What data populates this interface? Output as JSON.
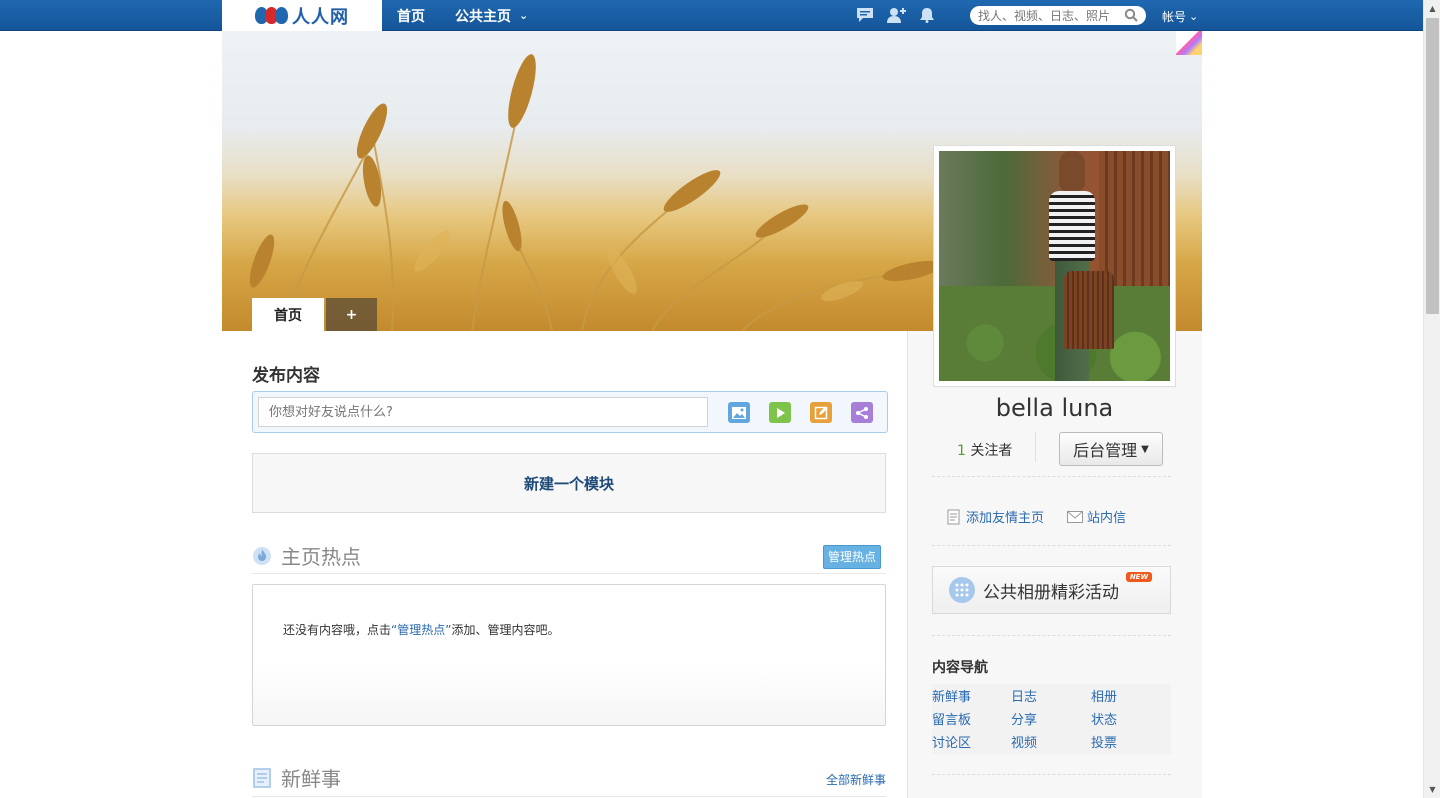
{
  "topbar": {
    "logo_text": "人人网",
    "nav": [
      {
        "label": "首页"
      },
      {
        "label": "公共主页"
      }
    ],
    "search_placeholder": "找人、视频、日志、照片",
    "account_label": "帐号",
    "icons": [
      "chat-icon",
      "add-friend-icon",
      "bell-icon",
      "search-icon"
    ]
  },
  "cover": {
    "tabs": [
      {
        "label": "首页"
      },
      {
        "label": "+"
      }
    ]
  },
  "profile": {
    "name": "bella luna",
    "followers_count": "1",
    "followers_label": "关注者",
    "admin_button": "后台管理",
    "links": [
      {
        "label": "添加友情主页",
        "icon": "document-icon"
      },
      {
        "label": "站内信",
        "icon": "mail-icon"
      }
    ],
    "album_button": "公共相册精彩活动",
    "album_badge": "NEW",
    "content_nav_title": "内容导航",
    "content_nav": [
      "新鲜事",
      "日志",
      "相册",
      "留言板",
      "分享",
      "状态",
      "讨论区",
      "视频",
      "投票"
    ]
  },
  "main": {
    "publish_title": "发布内容",
    "publish_placeholder": "你想对好友说点什么?",
    "tools": [
      "photo-icon",
      "video-icon",
      "blog-icon",
      "share-icon"
    ],
    "new_module_label": "新建一个模块",
    "hot_title": "主页热点",
    "manage_hot_button": "管理热点",
    "empty_prefix": "还没有内容哦，点击",
    "empty_link": "“管理热点”",
    "empty_suffix": "添加、管理内容吧。",
    "news_title": "新鲜事",
    "all_news_link": "全部新鲜事"
  },
  "colors": {
    "topbar": "#1f68b0",
    "link": "#2a6ab0",
    "manage_button": "#67b2e3",
    "new_badge": "#ef5a1c"
  }
}
